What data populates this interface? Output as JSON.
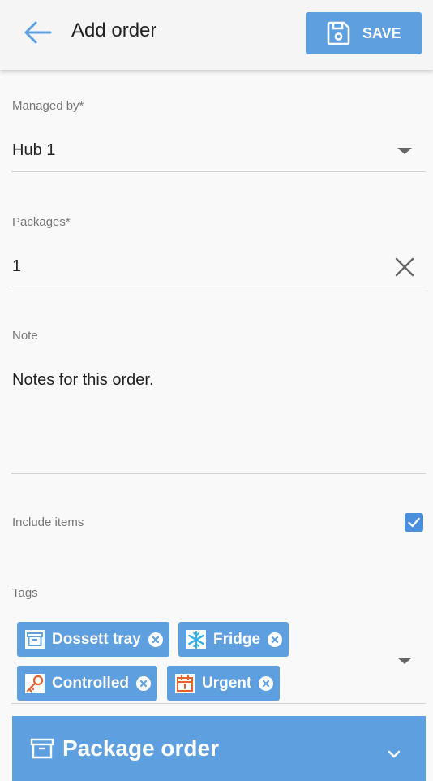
{
  "header": {
    "title": "Add order",
    "save_label": "SAVE"
  },
  "form": {
    "managed_by": {
      "label": "Managed by*",
      "value": "Hub 1"
    },
    "packages": {
      "label": "Packages*",
      "value": "1"
    },
    "note": {
      "label": "Note",
      "value": "Notes for this order."
    },
    "include_items": {
      "label": "Include items",
      "checked": true
    },
    "tags": {
      "label": "Tags",
      "items": [
        {
          "label": "Dossett tray",
          "icon": "archive-box-icon"
        },
        {
          "label": "Fridge",
          "icon": "snowflake-icon"
        },
        {
          "label": "Controlled",
          "icon": "key-icon"
        },
        {
          "label": "Urgent",
          "icon": "calendar-icon"
        }
      ]
    }
  },
  "panel": {
    "title": "Package order"
  },
  "colors": {
    "accent": "#5e9fe0",
    "checkbox": "#4a8fdc",
    "fridge_icon": "#2fb0e8",
    "controlled_icon": "#e8612c",
    "urgent_icon": "#e8612c"
  }
}
